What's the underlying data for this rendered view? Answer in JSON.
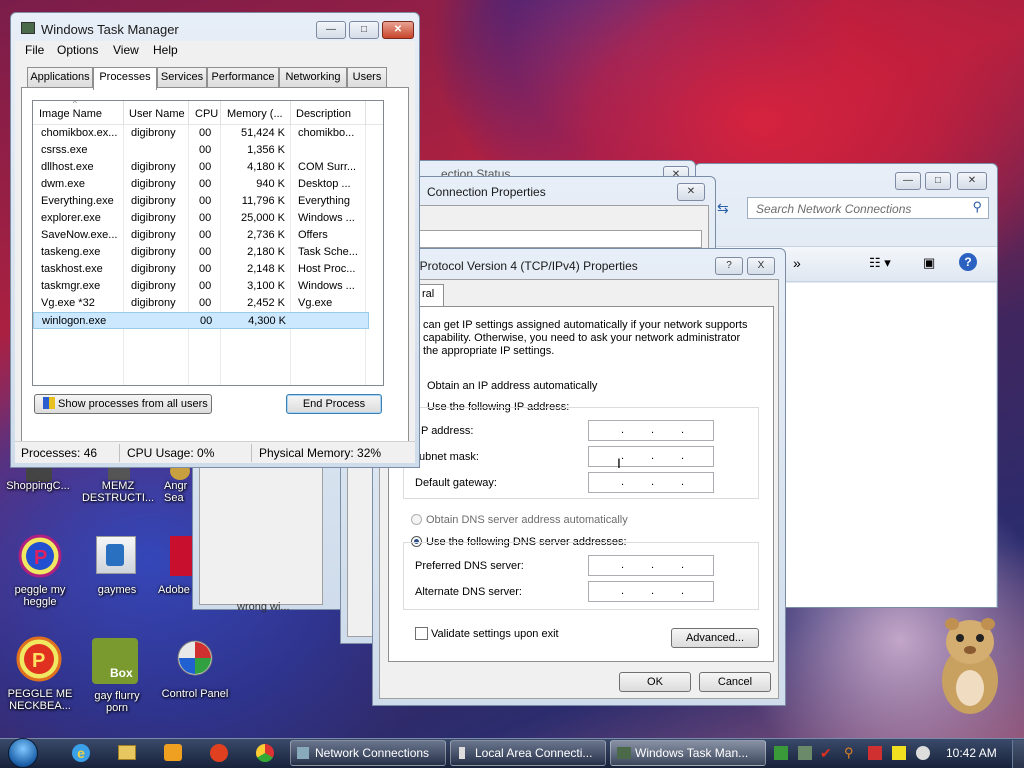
{
  "task_manager": {
    "title": "Windows Task Manager",
    "menu": [
      "File",
      "Options",
      "View",
      "Help"
    ],
    "tabs": [
      "Applications",
      "Processes",
      "Services",
      "Performance",
      "Networking",
      "Users"
    ],
    "columns": [
      "Image Name",
      "User Name",
      "CPU",
      "Memory (...",
      "Description"
    ],
    "rows": [
      [
        "chomikbox.ex...",
        "digibrony",
        "00",
        "51,424 K",
        "chomikbo..."
      ],
      [
        "csrss.exe",
        "",
        "00",
        "1,356 K",
        ""
      ],
      [
        "dllhost.exe",
        "digibrony",
        "00",
        "4,180 K",
        "COM Surr..."
      ],
      [
        "dwm.exe",
        "digibrony",
        "00",
        "940 K",
        "Desktop ..."
      ],
      [
        "Everything.exe",
        "digibrony",
        "00",
        "11,796 K",
        "Everything"
      ],
      [
        "explorer.exe",
        "digibrony",
        "00",
        "25,000 K",
        "Windows ..."
      ],
      [
        "SaveNow.exe...",
        "digibrony",
        "00",
        "2,736 K",
        "Offers"
      ],
      [
        "taskeng.exe",
        "digibrony",
        "00",
        "2,180 K",
        "Task Sche..."
      ],
      [
        "taskhost.exe",
        "digibrony",
        "00",
        "2,148 K",
        "Host Proc..."
      ],
      [
        "taskmgr.exe",
        "digibrony",
        "00",
        "3,100 K",
        "Windows ..."
      ],
      [
        "Vg.exe *32",
        "digibrony",
        "00",
        "2,452 K",
        "Vg.exe"
      ],
      [
        "winlogon.exe",
        "",
        "00",
        "4,300 K",
        ""
      ]
    ],
    "selected_row": 11,
    "show_all_label": "Show processes from all users",
    "end_process_label": "End Process",
    "status": {
      "processes": "Processes: 46",
      "cpu": "CPU Usage: 0%",
      "memory": "Physical Memory: 32%"
    }
  },
  "background_windows": {
    "status_title_fragment": "...ection Status",
    "conn_props_title": "Connection Properties",
    "search_placeholder": "Search Network Connections",
    "partial_text": "wrong wi..."
  },
  "tcpip_dialog": {
    "title": "t Protocol Version 4 (TCP/IPv4) Properties",
    "tab_label": "ral",
    "intro": [
      "can get IP settings assigned automatically if your network supports",
      "capability. Otherwise, you need to ask your network administrator",
      "the appropriate IP settings."
    ],
    "obtain_ip_auto": "Obtain an IP address automatically",
    "use_following_ip": "Use the following IP address:",
    "ip_address_label": "P address:",
    "subnet_label": "ubnet mask:",
    "gateway_label": "Default gateway:",
    "obtain_dns_auto": "Obtain DNS server address automatically",
    "use_following_dns": "Use the following DNS server addresses:",
    "preferred_dns_label": "Preferred DNS server:",
    "alternate_dns_label": "Alternate DNS server:",
    "validate_label": "Validate settings upon exit",
    "advanced_label": "Advanced...",
    "ok_label": "OK",
    "cancel_label": "Cancel",
    "help_glyph": "?",
    "close_glyph": "X"
  },
  "desktop_icons": [
    {
      "label": "ShoppingC...",
      "icon": "shopping-icon"
    },
    {
      "label": "MEMZ DESTRUCTI...",
      "icon": "memz-icon"
    },
    {
      "label": "Angr Sea",
      "icon": "angry-birds-icon"
    },
    {
      "label": "peggle my heggle",
      "icon": "peggle-icon"
    },
    {
      "label": "gaymes",
      "icon": "folder-icon"
    },
    {
      "label": "Adobe",
      "icon": "adobe-icon"
    },
    {
      "label": "PEGGLE ME NECKBEA...",
      "icon": "peggle-icon"
    },
    {
      "label": "gay flurry porn",
      "icon": "box-icon"
    },
    {
      "label": "Control Panel",
      "icon": "control-panel-icon"
    }
  ],
  "taskbar": {
    "buttons": [
      "Network Connections",
      "Local Area Connecti...",
      "Windows Task Man..."
    ],
    "clock": "10:42 AM",
    "box_icon_text": "Box"
  },
  "colors": {
    "selection": "#cce8ff",
    "taskbar": "#1c2a47",
    "accent": "#3c7fb1"
  }
}
